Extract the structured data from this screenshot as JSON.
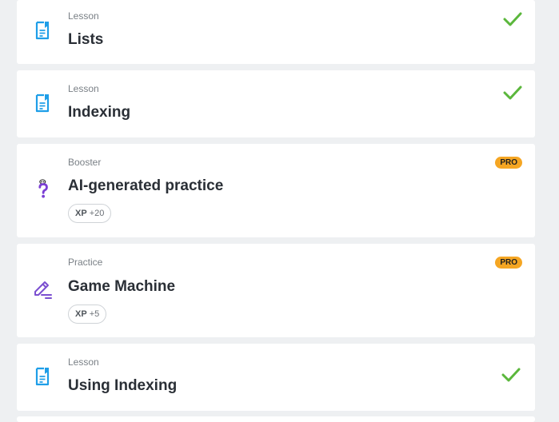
{
  "colors": {
    "background": "#eef0f2",
    "card": "#ffffff",
    "lesson_icon": "#1e9ee8",
    "booster_icon": "#7b3fd4",
    "practice_icon": "#7b4fd0",
    "check": "#5bb73c",
    "pro_badge": "#f5a623"
  },
  "items": [
    {
      "type": "Lesson",
      "title": "Lists",
      "icon": "lesson-document-icon",
      "status": "completed"
    },
    {
      "type": "Lesson",
      "title": "Indexing",
      "icon": "lesson-document-icon",
      "status": "completed"
    },
    {
      "type": "Booster",
      "title": "AI-generated practice",
      "icon": "question-mark-icon",
      "badge": "PRO",
      "xp_label": "XP",
      "xp_value": "+20"
    },
    {
      "type": "Practice",
      "title": "Game Machine",
      "icon": "pencil-edit-icon",
      "badge": "PRO",
      "xp_label": "XP",
      "xp_value": "+5"
    },
    {
      "type": "Lesson",
      "title": "Using Indexing",
      "icon": "lesson-document-icon",
      "status": "completed"
    }
  ]
}
